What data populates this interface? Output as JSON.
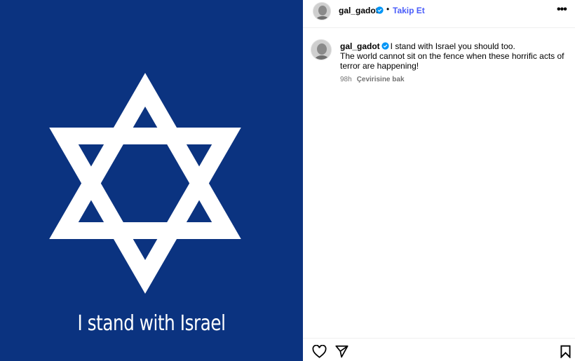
{
  "post": {
    "image_caption": "I stand with Israel",
    "colors": {
      "flag_blue": "#0b3380",
      "star_white": "#ffffff",
      "link_blue": "#4a5df9"
    }
  },
  "header": {
    "username": "gal_gadot",
    "separator": "•",
    "follow_label": "Takip Et",
    "more_icon": "more-options-icon"
  },
  "comment": {
    "username": "gal_gadot",
    "line1": "I stand with Israel you should too.",
    "line2": "The world cannot sit on the fence when these horrific acts of terror are happening!",
    "time": "98h",
    "translate_label": "Çevirisine bak"
  },
  "actions": {
    "like_icon": "heart-icon",
    "share_icon": "send-icon",
    "save_icon": "bookmark-icon"
  }
}
